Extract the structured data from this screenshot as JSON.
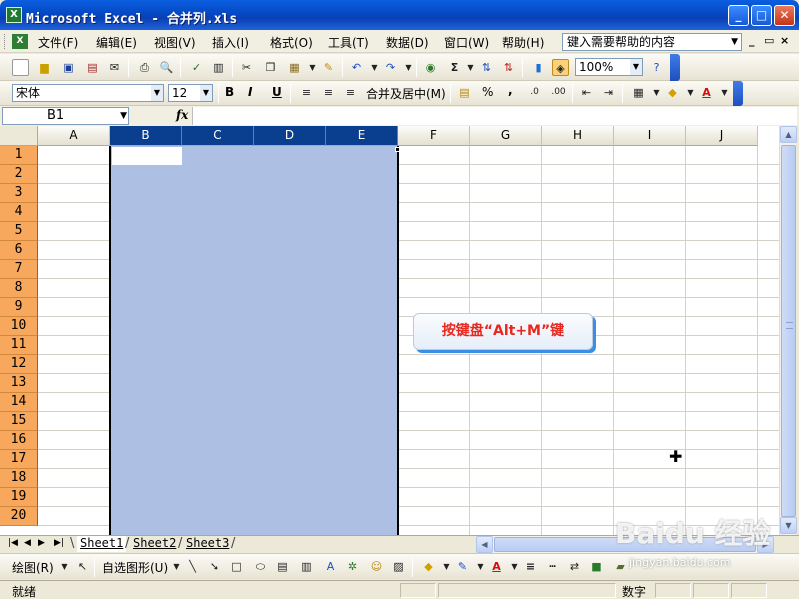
{
  "window": {
    "title": "Microsoft Excel - 合并列.xls",
    "minimize": "_",
    "maximize": "□",
    "close": "✕"
  },
  "menu": {
    "items": [
      "文件(F)",
      "编辑(E)",
      "视图(V)",
      "插入(I)",
      "格式(O)",
      "工具(T)",
      "数据(D)",
      "窗口(W)",
      "帮助(H)"
    ],
    "help_box": "键入需要帮助的内容",
    "mdi_min": "_",
    "mdi_restore": "▭",
    "mdi_close": "×"
  },
  "toolbar1": {
    "zoom": "100%",
    "sum": "Σ"
  },
  "toolbar2": {
    "font": "宋体",
    "size": "12",
    "bold": "B",
    "italic": "I",
    "underline": "U",
    "merge_center": "合并及居中(M)",
    "percent": "%",
    "comma": ","
  },
  "formula_bar": {
    "name_box": "B1",
    "fx": "fx",
    "value": ""
  },
  "grid": {
    "columns": [
      "A",
      "B",
      "C",
      "D",
      "E",
      "F",
      "G",
      "H",
      "I",
      "J"
    ],
    "selected_columns": [
      "B",
      "C",
      "D",
      "E"
    ],
    "rows": [
      "1",
      "2",
      "3",
      "4",
      "5",
      "6",
      "7",
      "8",
      "9",
      "10",
      "11",
      "12",
      "13",
      "14",
      "15",
      "16",
      "17",
      "18",
      "19",
      "20"
    ],
    "active_cell": "B1"
  },
  "sheets": {
    "tabs": [
      "Sheet1",
      "Sheet2",
      "Sheet3"
    ],
    "active": "Sheet1"
  },
  "drawing_toolbar": {
    "draw": "绘图(R)",
    "autoshapes": "自选图形(U)"
  },
  "status": {
    "ready": "就绪",
    "mode": "数字"
  },
  "callout": {
    "text": "按键盘“Alt+M”键"
  },
  "watermark": {
    "brand": "Baidu 经验",
    "url": "jingyan.baidu.com"
  }
}
